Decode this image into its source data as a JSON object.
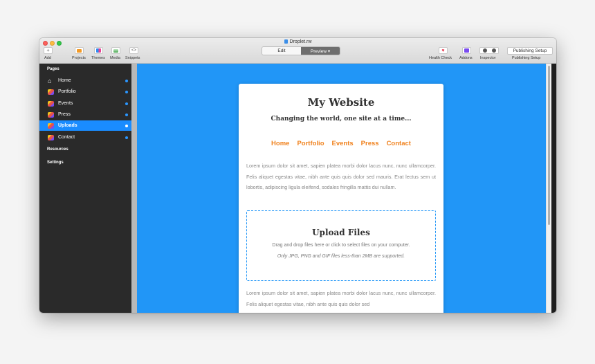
{
  "window": {
    "title": "Droplet.rw"
  },
  "toolbar": {
    "add_label": "Add",
    "projects_label": "Projects",
    "themes_label": "Themes",
    "media_label": "Media",
    "snippets_label": "Snippets",
    "edit_label": "Edit",
    "preview_label": "Preview ▾",
    "health_check_label": "Health Check",
    "addons_label": "Addons",
    "inspector_label": "Inspector",
    "publishing_setup_button": "Publishing Setup",
    "publishing_setup_label": "Publishing Setup"
  },
  "sidebar": {
    "pages_heading": "Pages",
    "items": [
      {
        "label": "Home",
        "icon": "home-icon"
      },
      {
        "label": "Portfolio",
        "icon": "page-icon"
      },
      {
        "label": "Events",
        "icon": "page-icon"
      },
      {
        "label": "Press",
        "icon": "page-icon"
      },
      {
        "label": "Uploads",
        "icon": "page-icon",
        "active": true
      },
      {
        "label": "Contact",
        "icon": "page-icon"
      }
    ],
    "resources_heading": "Resources",
    "settings_heading": "Settings"
  },
  "site": {
    "title": "My Website",
    "tagline": "Changing the world, one site at a time...",
    "nav": [
      "Home",
      "Portfolio",
      "Events",
      "Press",
      "Contact"
    ],
    "paragraph1": "Lorem ipsum dolor sit amet, sapien platea morbi dolor lacus nunc, nunc ullamcorper. Felis aliquet egestas vitae, nibh ante quis quis dolor sed mauris. Erat lectus sem ut lobortis, adipiscing ligula eleifend, sodales fringilla mattis dui nullam.",
    "upload": {
      "title": "Upload Files",
      "description": "Drag and drop files here or click to select files on your computer.",
      "note": "Only JPG, PNG and GIF files less-than 2MB are supported."
    },
    "paragraph2": "Lorem ipsum dolor sit amet, sapien platea morbi dolor lacus nunc, nunc ullamcorper. Felis aliquet egestas vitae, nibh ante quis quis dolor sed"
  },
  "colors": {
    "preview_background": "#2196f7",
    "nav_link": "#f0821e",
    "sidebar_active": "#1a8cff",
    "sidebar_background": "#2a2a2a"
  }
}
